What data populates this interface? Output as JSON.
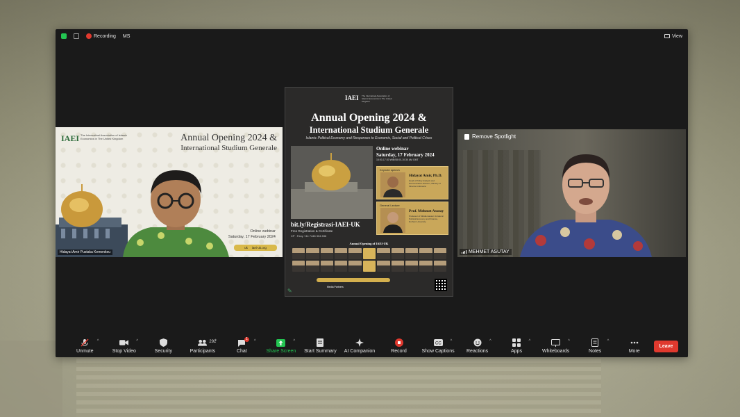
{
  "topbar": {
    "recording_label": "Recording",
    "user_initials": "MS",
    "view_label": "View"
  },
  "left_tile": {
    "logo_text": "IAEI",
    "logo_sub": "The Internatioal Association of Islamic Economics in The United Kingdom",
    "title_line1": "Annual Opening 2024 &",
    "title_line2": "International Studium Generale",
    "webinar_line1": "Online webinar",
    "webinar_line2": "Saturday, 17 February 2024",
    "url_text": "iaei-uk.org",
    "url_prefix": "uk",
    "participant_name": "Hidayat Amir Pustaka Kemenkeu"
  },
  "poster": {
    "logo_text": "IAEI",
    "logo_sub": "The Internatioal Association of Islamic Economics in The United Kingdom",
    "title_line1": "Annual Opening 2024 &",
    "title_line2": "International Studium Generale",
    "subtitle": "Islamic Political Economy and Responses to Economic, Social and Political Crises",
    "online_line1": "Online webinar",
    "online_line2": "Saturday, 17 February 2024",
    "online_time": "15:00-17:30 WIB/08:00-10:30 AM GMT",
    "keynote_label": "Keynote speech",
    "keynote_name": "Hidayat Amir, Ph.D.",
    "keynote_desc": "Head of Policy Analysis and Harmonization Division, Ministry of Finance Indonesia",
    "lecture_label": "General Lecture",
    "lecture_name": "Prof. Mehmet Asutay",
    "lecture_desc": "Professor of Middle Eastern & Islamic Political Economy and Finance, Durham University",
    "reg_link": "bit.ly/Registrasi-IAEI-UK",
    "reg_free": "Free Registration & Certificate",
    "reg_cp": "CP : Fany +44 7448 304 836",
    "annual_label": "Annual Opening of IAEI-UK",
    "media_label": "Media Partners"
  },
  "right_tile": {
    "spotlight_label": "Remove Spotlight",
    "participant_name": "MEHMET ASUTAY"
  },
  "toolbar": {
    "items": [
      {
        "label": "Unmute",
        "icon": "muted-mic-icon"
      },
      {
        "label": "Stop Video",
        "icon": "video-camera-icon"
      },
      {
        "label": "Security",
        "icon": "shield-icon"
      },
      {
        "label": "Participants",
        "icon": "participants-icon",
        "count": "292"
      },
      {
        "label": "Chat",
        "icon": "chat-icon",
        "badge": "1"
      },
      {
        "label": "Share Screen",
        "icon": "share-screen-icon"
      },
      {
        "label": "Start Summary",
        "icon": "summary-icon"
      },
      {
        "label": "AI Companion",
        "icon": "ai-sparkle-icon"
      },
      {
        "label": "Record",
        "icon": "record-icon"
      },
      {
        "label": "Show Captions",
        "icon": "captions-icon"
      },
      {
        "label": "Reactions",
        "icon": "reactions-icon"
      },
      {
        "label": "Apps",
        "icon": "apps-icon"
      },
      {
        "label": "Whiteboards",
        "icon": "whiteboard-icon"
      },
      {
        "label": "Notes",
        "icon": "notes-icon"
      },
      {
        "label": "More",
        "icon": "more-dots-icon"
      }
    ],
    "leave_label": "Leave"
  },
  "colors": {
    "accent_green": "#23c552",
    "leave_red": "#e0392e",
    "window_bg": "#1a1a1a"
  }
}
